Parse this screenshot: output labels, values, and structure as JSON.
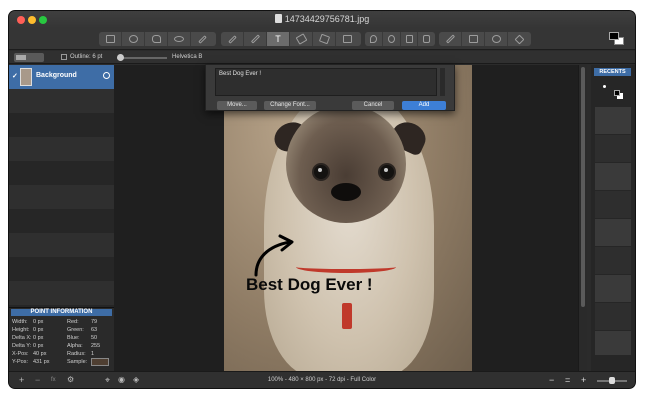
{
  "window": {
    "title": "14734429756781.jpg",
    "traffic_colors": [
      "#ff5f57",
      "#febc2e",
      "#28c840"
    ]
  },
  "toolbar": {
    "groups": [
      {
        "tools": [
          "rect-select-icon",
          "ellipse-select-icon",
          "lasso-icon",
          "oval-icon",
          "magic-wand-icon"
        ]
      },
      {
        "tools": [
          "pen-icon",
          "brush-icon",
          "text-icon",
          "eraser-icon",
          "paint-bucket-icon",
          "clone-stamp-icon"
        ]
      },
      {
        "tools": [
          "blur-icon",
          "dodge-icon",
          "burn-icon",
          "sponge-icon"
        ]
      },
      {
        "tools": [
          "eyedropper-icon",
          "crop-icon",
          "zoom-icon",
          "move-icon"
        ]
      }
    ],
    "active_tool_glyph": "T"
  },
  "options_bar": {
    "outline_label": "Outline: 6 pt",
    "font_label": "Helvetica B"
  },
  "text_dialog": {
    "text_value": "Best Dog Ever !",
    "buttons": {
      "move": "Move...",
      "change_font": "Change Font...",
      "cancel": "Cancel",
      "add": "Add"
    }
  },
  "layers": {
    "items": [
      {
        "label": "Background",
        "checked": true
      }
    ]
  },
  "point_info": {
    "title": "POINT INFORMATION",
    "left": [
      {
        "label": "Width:",
        "value": "0 px"
      },
      {
        "label": "Height:",
        "value": "0 px"
      },
      {
        "label": "Delta X:",
        "value": "0 px"
      },
      {
        "label": "Delta Y:",
        "value": "0 px"
      },
      {
        "label": "X-Pos:",
        "value": "40 px"
      },
      {
        "label": "Y-Pos:",
        "value": "431 px"
      }
    ],
    "right": [
      {
        "label": "Red:",
        "value": "79"
      },
      {
        "label": "Green:",
        "value": "63"
      },
      {
        "label": "Blue:",
        "value": "50"
      },
      {
        "label": "Alpha:",
        "value": "255"
      },
      {
        "label": "Radius:",
        "value": "1"
      },
      {
        "label": "Sample:",
        "value": ""
      }
    ],
    "sample_color": "#4f3f32"
  },
  "canvas": {
    "caption_text": "Best Dog Ever !"
  },
  "recents": {
    "title": "RECENTS"
  },
  "statusbar": {
    "info": "100% - 480 × 800 px - 72 dpi - Full Color",
    "left_buttons": [
      "+",
      "−",
      "fx",
      "⚙"
    ],
    "right_buttons": [
      "−",
      "=",
      "+"
    ]
  },
  "colors": {
    "accent": "#3e6da6",
    "primary_button": "#3d7fd6"
  }
}
